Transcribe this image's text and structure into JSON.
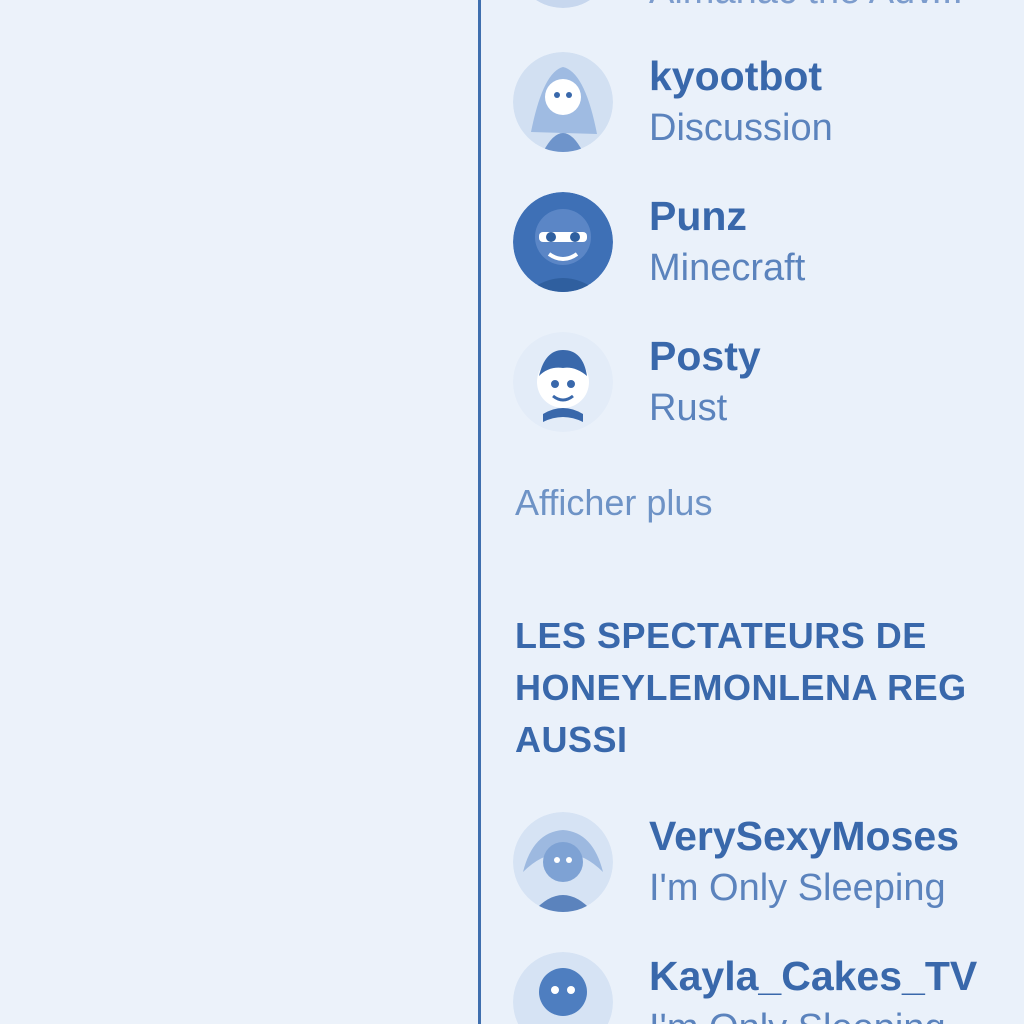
{
  "colors": {
    "accent": "#3968ab",
    "secondary_text": "#5b83bd",
    "background": "#eaf1fa",
    "divider": "#3f6fae"
  },
  "top_cutoff": {
    "game": "Almanac the Adv..."
  },
  "channels": [
    {
      "name": "kyootbot",
      "game": "Discussion",
      "avatar_icon": "streamer-avatar-icon"
    },
    {
      "name": "Punz",
      "game": "Minecraft",
      "avatar_icon": "streamer-avatar-icon"
    },
    {
      "name": "Posty",
      "game": "Rust",
      "avatar_icon": "streamer-avatar-icon"
    }
  ],
  "show_more_label": "Afficher plus",
  "section": {
    "title_lines": [
      "LES SPECTATEURS DE",
      "HONEYLEMONLENA REG",
      "AUSSI"
    ]
  },
  "related_channels": [
    {
      "name": "VerySexyMoses",
      "game": "I'm Only Sleeping",
      "avatar_icon": "streamer-avatar-icon"
    },
    {
      "name": "Kayla_Cakes_TV",
      "game": "I'm Only Sleeping",
      "avatar_icon": "streamer-avatar-icon"
    }
  ]
}
